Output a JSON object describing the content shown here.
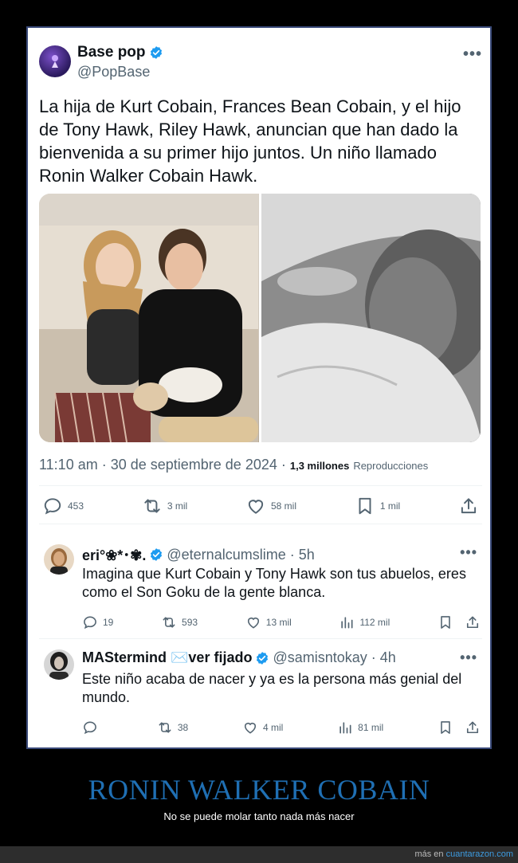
{
  "main_tweet": {
    "display_name": "Base pop",
    "handle": "@PopBase",
    "more": "•••",
    "text": "La hija de Kurt Cobain, Frances Bean Cobain, y el hijo de Tony Hawk, Riley Hawk, anuncian que han dado la bienvenida a su primer hijo juntos. Un niño llamado Ronin Walker Cobain Hawk.",
    "timestamp": "11:10 am · 30 de septiembre de 2024 ·",
    "views_count": "1,3 millones",
    "views_label": "Reproducciones",
    "stats": {
      "replies": "453",
      "reposts": "3 mil",
      "likes": "58 mil",
      "bookmarks": "1 mil"
    }
  },
  "replies": [
    {
      "display_name": "eri°❀*･✾.",
      "handle": "@eternalcumslime · 5h",
      "more": "•••",
      "text": "Imagina que Kurt Cobain y Tony Hawk son tus abuelos, eres como el Son Goku de la gente blanca.",
      "replies": "19",
      "reposts": "593",
      "likes": "13 mil",
      "views": "112 mil"
    },
    {
      "display_name": "MAStermind ✉️ver fijado",
      "handle": "@samisntokay · 4h",
      "more": "•••",
      "text": "Este niño acaba de nacer y ya es la persona más genial del mundo.",
      "replies": "",
      "reposts": "38",
      "likes": "4 mil",
      "views": "81 mil"
    }
  ],
  "caption": {
    "title": "RONIN WALKER COBAIN",
    "subtitle": "No se puede molar tanto nada más nacer"
  },
  "footer": {
    "prefix": "más en",
    "link": "cuantarazon.com"
  },
  "colors": {
    "accent": "#1d9bf0",
    "caption_title": "#1f6fb3",
    "muted": "#536471"
  }
}
